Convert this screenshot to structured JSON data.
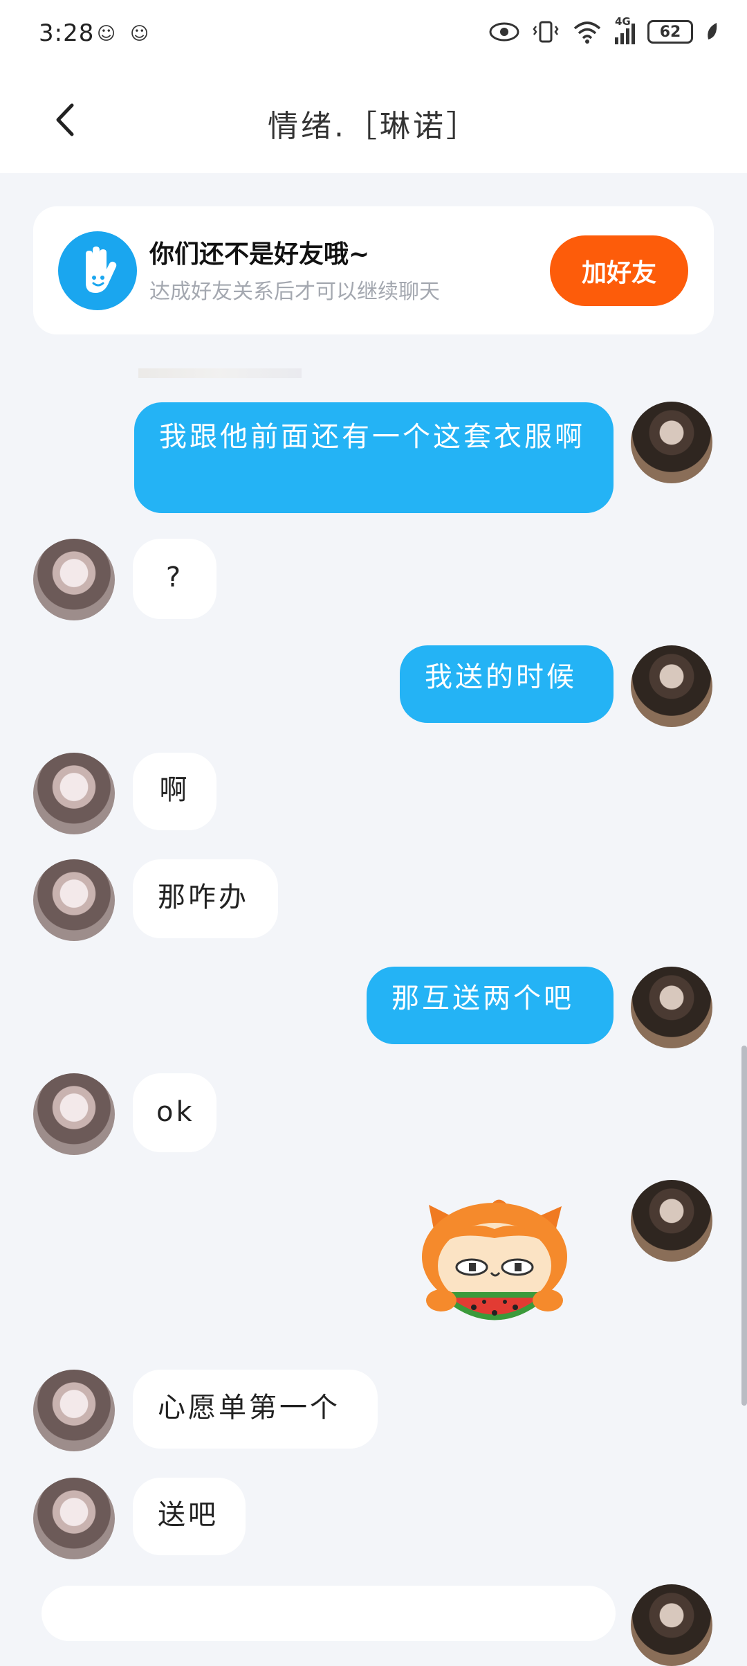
{
  "status_bar": {
    "time": "3:28",
    "network": "4G",
    "battery": "62"
  },
  "header": {
    "title": "情绪.［琳诺］"
  },
  "friend_card": {
    "title": "你们还不是好友哦~",
    "subtitle": "达成好友关系后才可以继续聊天",
    "button": "加好友"
  },
  "messages": [
    {
      "side": "out",
      "text": "我跟他前面还有一个这套衣服啊"
    },
    {
      "side": "in",
      "text": "?"
    },
    {
      "side": "out",
      "text": "我送的时候"
    },
    {
      "side": "in",
      "text": "啊"
    },
    {
      "side": "in",
      "text": "那咋办"
    },
    {
      "side": "out",
      "text": "那互送两个吧"
    },
    {
      "side": "in",
      "text": "ok"
    },
    {
      "side": "out",
      "sticker": "watermelon-cat-sticker"
    },
    {
      "side": "in",
      "text": "心愿单第一个"
    },
    {
      "side": "in",
      "text": "送吧"
    }
  ],
  "colors": {
    "outgoing_bubble": "#24b3f5",
    "add_button": "#fd5c0a",
    "hand_icon": "#1aa6ef",
    "background": "#f3f5f9"
  }
}
